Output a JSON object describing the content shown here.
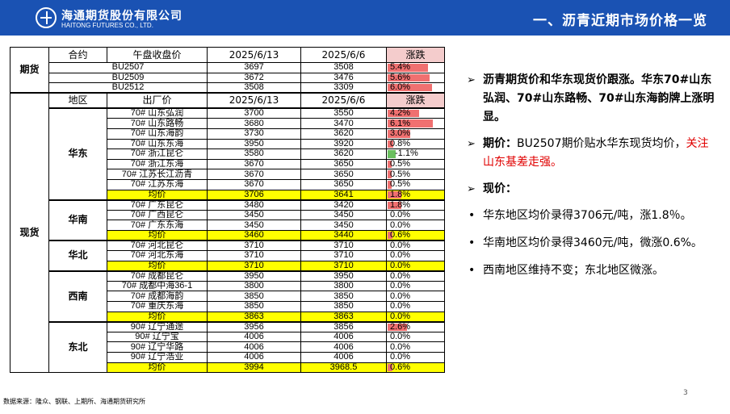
{
  "header": {
    "logo_cn": "海通期货股份有限公司",
    "logo_en": "HAITONG FUTURES CO., LTD.",
    "title": "一、沥青近期市场价格一览",
    "bg_color": "#1a52b3"
  },
  "table": {
    "futures_header": [
      "合约",
      "午盘收盘价",
      "2025/6/13",
      "2025/6/6",
      "涨跌"
    ],
    "futures_category": "期货",
    "futures_rows": [
      {
        "contract": "BU2507",
        "noon": "3697",
        "d1": "3508",
        "chg": "5.4%",
        "pct": 5.4
      },
      {
        "contract": "BU2509",
        "noon": "3672",
        "d1": "3476",
        "chg": "5.6%",
        "pct": 5.6
      },
      {
        "contract": "BU2512",
        "noon": "3508",
        "d1": "3309",
        "chg": "6.0%",
        "pct": 6.0
      }
    ],
    "spot_header": [
      "地区",
      "出厂价",
      "2025/6/13",
      "2025/6/6",
      "涨跌"
    ],
    "spot_category": "现货",
    "regions": [
      {
        "name": "华东",
        "rows": [
          {
            "name": "70# 山东弘润",
            "d0": "3700",
            "d1": "3550",
            "chg": "4.2%",
            "pct": 4.2
          },
          {
            "name": "70# 山东路畅",
            "d0": "3680",
            "d1": "3470",
            "chg": "6.1%",
            "pct": 6.1
          },
          {
            "name": "70# 山东海韵",
            "d0": "3730",
            "d1": "3620",
            "chg": "3.0%",
            "pct": 3.0
          },
          {
            "name": "70# 山东东海",
            "d0": "3950",
            "d1": "3920",
            "chg": "0.8%",
            "pct": 0.8
          },
          {
            "name": "70# 浙江昆仑",
            "d0": "3580",
            "d1": "3620",
            "chg": "-1.1%",
            "pct": -1.1
          },
          {
            "name": "70# 浙江东海",
            "d0": "3670",
            "d1": "3650",
            "chg": "0.5%",
            "pct": 0.5
          },
          {
            "name": "70# 江苏长江沥青",
            "d0": "3670",
            "d1": "3650",
            "chg": "0.5%",
            "pct": 0.5
          },
          {
            "name": "70# 江苏东海",
            "d0": "3670",
            "d1": "3650",
            "chg": "0.5%",
            "pct": 0.5
          }
        ],
        "avg": {
          "name": "均价",
          "d0": "3706",
          "d1": "3641",
          "chg": "1.8%",
          "pct": 1.8
        }
      },
      {
        "name": "华南",
        "rows": [
          {
            "name": "70# 广东昆仑",
            "d0": "3480",
            "d1": "3420",
            "chg": "1.8%",
            "pct": 1.8
          },
          {
            "name": "70# 广西昆仑",
            "d0": "3450",
            "d1": "3450",
            "chg": "0.0%",
            "pct": 0.0
          },
          {
            "name": "70# 广东东海",
            "d0": "3450",
            "d1": "3450",
            "chg": "0.0%",
            "pct": 0.0
          }
        ],
        "avg": {
          "name": "均价",
          "d0": "3460",
          "d1": "3440",
          "chg": "0.6%",
          "pct": 0.6
        }
      },
      {
        "name": "华北",
        "rows": [
          {
            "name": "70# 河北昆仑",
            "d0": "3710",
            "d1": "3710",
            "chg": "0.0%",
            "pct": 0.0
          },
          {
            "name": "70# 河北东海",
            "d0": "3710",
            "d1": "3710",
            "chg": "0.0%",
            "pct": 0.0
          }
        ],
        "avg": {
          "name": "均价",
          "d0": "3710",
          "d1": "3710",
          "chg": "0.0%",
          "pct": 0.0
        }
      },
      {
        "name": "西南",
        "rows": [
          {
            "name": "70# 成都昆仑",
            "d0": "3950",
            "d1": "3950",
            "chg": "0.0%",
            "pct": 0.0
          },
          {
            "name": "70# 成都中海36-1",
            "d0": "3800",
            "d1": "3800",
            "chg": "0.0%",
            "pct": 0.0
          },
          {
            "name": "70# 成都海韵",
            "d0": "3850",
            "d1": "3850",
            "chg": "0.0%",
            "pct": 0.0
          },
          {
            "name": "70# 重庆东海",
            "d0": "3850",
            "d1": "3850",
            "chg": "0.0%",
            "pct": 0.0
          }
        ],
        "avg": {
          "name": "均价",
          "d0": "3863",
          "d1": "3863",
          "chg": "0.0%",
          "pct": 0.0
        }
      },
      {
        "name": "东北",
        "rows": [
          {
            "name": "90# 辽宁通途",
            "d0": "3956",
            "d1": "3856",
            "chg": "2.6%",
            "pct": 2.6
          },
          {
            "name": "90# 辽宁宝",
            "d0": "4006",
            "d1": "4006",
            "chg": "0.0%",
            "pct": 0.0
          },
          {
            "name": "90# 辽宁华路",
            "d0": "4006",
            "d1": "4006",
            "chg": "0.0%",
            "pct": 0.0
          },
          {
            "name": "90# 辽宁浩业",
            "d0": "4006",
            "d1": "4006",
            "chg": "0.0%",
            "pct": 0.0
          }
        ],
        "avg": {
          "name": "均价",
          "d0": "3994",
          "d1": "3968.5",
          "chg": "0.6%",
          "pct": 0.6
        }
      }
    ]
  },
  "bullets": {
    "p1": "沥青期货价和华东现货价跟涨。华东70#山东弘润、70#山东路畅、70#山东海韵牌上涨明显。",
    "p2_label": "期价：",
    "p2_text": "BU2507期价贴水华东现货均价，",
    "p2_red": "关注山东基差走强。",
    "p3_label": "现价：",
    "d1": "华东地区均价录得3706元/吨，涨1.8％。",
    "d2": "华南地区均价录得3460元/吨，微涨0.6%。",
    "d3": "西南地区维持不变；东北地区微涨。"
  },
  "footer": {
    "source": "数据来源：隆众、钢联、上期所、海通期货研究所",
    "page": "3"
  }
}
